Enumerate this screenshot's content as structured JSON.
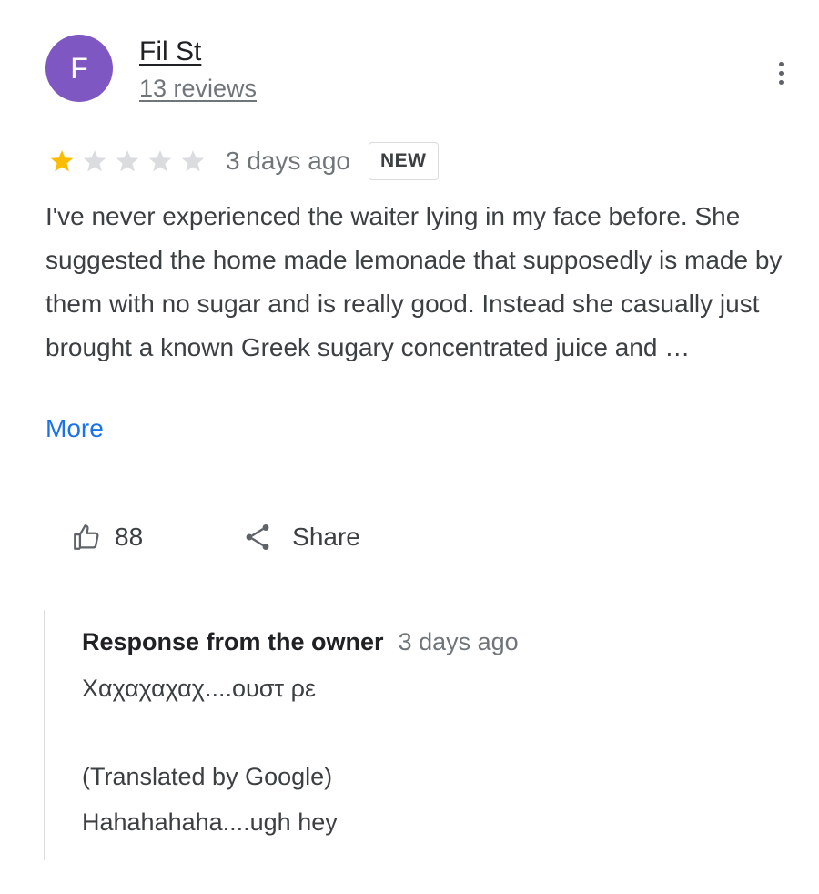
{
  "review": {
    "author": {
      "initial": "F",
      "name": "Fil St",
      "reviews": "13 reviews",
      "avatar_color": "#7e57c2"
    },
    "menu_icon": "more-vert-icon",
    "rating": 1,
    "rating_max": 5,
    "star_filled_color": "#fbbc04",
    "star_empty_color": "#dadce0",
    "date": "3 days ago",
    "badge": "NEW",
    "text": "I've never experienced the waiter lying in my face before. She suggested the home made lemonade that supposedly is made by them with no sugar and is really good. Instead she casually just brought a known Greek sugary concentrated juice and …",
    "more_label": "More",
    "likes": "88",
    "like_icon": "thumbs-up-icon",
    "share_label": "Share",
    "share_icon": "share-icon",
    "link_color": "#1a73e8"
  },
  "owner_response": {
    "title": "Response from the owner",
    "date": "3 days ago",
    "original": "Χαχαχαχαχ....ουστ ρε",
    "translation_note": "(Translated by Google)",
    "translated": "Hahahahaha....ugh hey"
  }
}
